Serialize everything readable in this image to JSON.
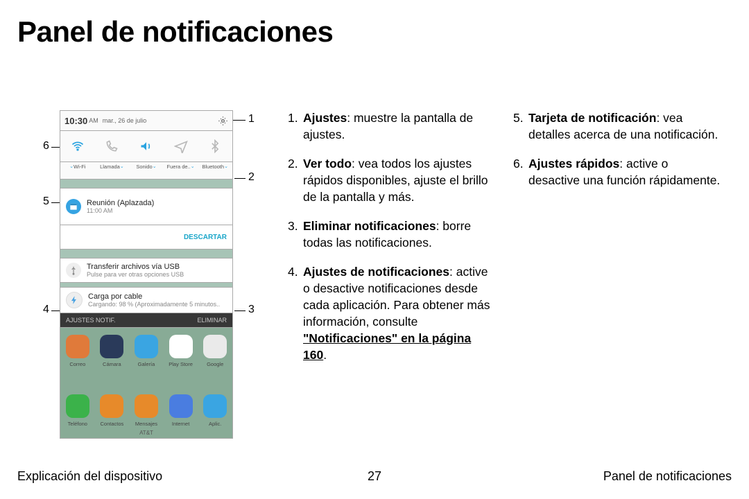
{
  "title": "Panel de notificaciones",
  "phone": {
    "time": "10:30",
    "ampm": "AM",
    "date": "mar., 26 de julio",
    "qs_labels": [
      "Wi-Fi",
      "Llamada",
      "Sonido",
      "Fuera de..",
      "Bluetooth"
    ],
    "reunion_title": "Reunión  (Aplazada)",
    "reunion_time": "11:00 AM",
    "descartar": "DESCARTAR",
    "usb_title": "Transferir archivos vía USB",
    "usb_sub": "Pulse para ver otras opciones USB",
    "carga_title": "Carga por cable",
    "carga_sub": "Cargando: 98 % (Aproximadamente 5 minutos..",
    "ajustes_notif": "AJUSTES NOTIF.",
    "eliminar": "ELIMINAR",
    "apps_r1": [
      "Correo",
      "Cámara",
      "Galería",
      "Play Store",
      "Google"
    ],
    "apps_r2": [
      "Teléfono",
      "Contactos",
      "Mensajes",
      "Internet",
      "Aplic."
    ],
    "carrier": "AT&T",
    "app_colors_r1": [
      "#e07a3a",
      "#2a3a5a",
      "#3aa5e2",
      "#ffffff",
      "#eaeaea"
    ],
    "app_colors_r2": [
      "#3bb24a",
      "#e78a2a",
      "#e78a2a",
      "#4a7de0",
      "#3aa5e2"
    ]
  },
  "callouts": {
    "c1": "1",
    "c2": "2",
    "c3": "3",
    "c4": "4",
    "c5": "5",
    "c6": "6"
  },
  "list1": [
    {
      "b": "Ajustes",
      "t": ": muestre la pantalla de ajustes."
    },
    {
      "b": "Ver todo",
      "t": ": vea todos los ajustes rápidos disponibles, ajuste el brillo de la pantalla y más."
    },
    {
      "b": "Eliminar notificaciones",
      "t": ": borre todas las notificaciones."
    },
    {
      "b": "Ajustes de notificaciones",
      "t": ": active o desactive notificaciones desde cada aplicación. Para obtener más información, consulte ",
      "link": "\"Notificaciones\" en la página 160",
      "post": "."
    }
  ],
  "list2": [
    {
      "b": "Tarjeta de notificación",
      "t": ": vea detalles acerca de una notificación."
    },
    {
      "b": "Ajustes rápidos",
      "t": ": active o desactive una función rápidamente."
    }
  ],
  "footer": {
    "left": "Explicación del dispositivo",
    "page": "27",
    "right": "Panel de notificaciones"
  }
}
